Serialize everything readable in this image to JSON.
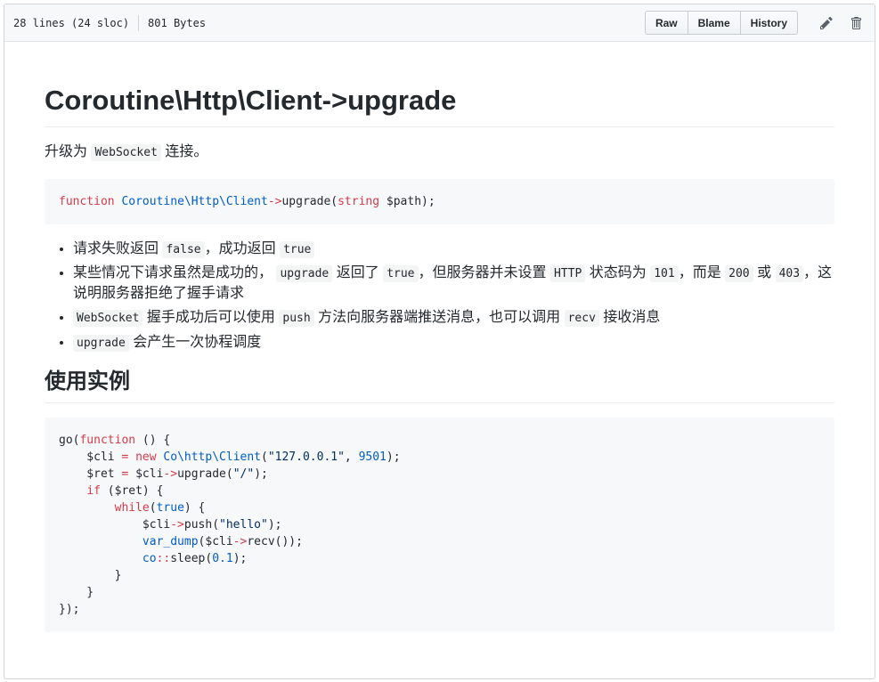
{
  "header": {
    "lines": "28 lines (24 sloc)",
    "size": "801 Bytes",
    "raw_label": "Raw",
    "blame_label": "Blame",
    "history_label": "History"
  },
  "content": {
    "title": "Coroutine\\Http\\Client->upgrade",
    "intro_before": "升级为",
    "intro_code": "WebSocket",
    "intro_after": "连接。",
    "signature": {
      "kw_function": "function",
      "class": "Coroutine\\Http\\Client",
      "arrow": "->",
      "method": "upgrade(",
      "type": "string",
      "param": "$path);"
    },
    "bullets": [
      {
        "t1": "请求失败返回",
        "c1": "false",
        "t2": "，成功返回",
        "c2": "true"
      },
      {
        "t1": "某些情况下请求虽然是成功的，",
        "c1": "upgrade",
        "t2": "返回了",
        "c2": "true",
        "t3": "，但服务器并未设置",
        "c3": "HTTP",
        "t4": "状态码为",
        "c4": "101",
        "t5": "，而是",
        "c5": "200",
        "t6": "或",
        "c6": "403",
        "t7": "，这说明服务器拒绝了握手请求"
      },
      {
        "c1": "WebSocket",
        "t1": "握手成功后可以使用",
        "c2": "push",
        "t2": "方法向服务器端推送消息，也可以调用",
        "c3": "recv",
        "t3": "接收消息"
      },
      {
        "c1": "upgrade",
        "t1": "会产生一次协程调度"
      }
    ],
    "example_title": "使用实例",
    "example": {
      "l1a": "go(",
      "l1b": "function",
      "l1c": " () {",
      "l2a": "    $cli ",
      "l2b": "=",
      "l2c": " ",
      "l2d": "new",
      "l2e": " ",
      "l2f": "Co\\http\\Client",
      "l2g": "(",
      "l2h": "\"127.0.0.1\"",
      "l2i": ", ",
      "l2j": "9501",
      "l2k": ");",
      "l3a": "    $ret ",
      "l3b": "=",
      "l3c": " $cli",
      "l3d": "->",
      "l3e": "upgrade(",
      "l3f": "\"/\"",
      "l3g": ");",
      "l4a": "    ",
      "l4b": "if",
      "l4c": " ($ret) {",
      "l5a": "        ",
      "l5b": "while",
      "l5c": "(",
      "l5d": "true",
      "l5e": ") {",
      "l6a": "            $cli",
      "l6b": "->",
      "l6c": "push(",
      "l6d": "\"hello\"",
      "l6e": ");",
      "l7a": "            ",
      "l7b": "var_dump",
      "l7c": "($cli",
      "l7d": "->",
      "l7e": "recv());",
      "l8a": "            ",
      "l8b": "co",
      "l8c": "::",
      "l8d": "sleep(",
      "l8e": "0.1",
      "l8f": ");",
      "l9": "        }",
      "l10": "    }",
      "l11": "});"
    }
  },
  "colors": {
    "keyword": "#d73a49",
    "entity": "#005cc5",
    "string": "#032f62"
  }
}
